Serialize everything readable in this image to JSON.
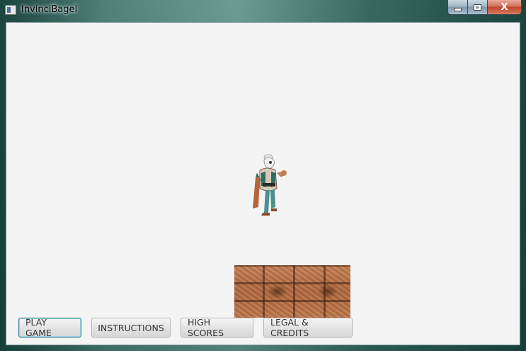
{
  "window": {
    "title": "InvinciBagel",
    "controls": {
      "minimize_icon": "minimize-icon",
      "maximize_icon": "maximize-icon",
      "close_label": "X"
    }
  },
  "game": {
    "background_color": "#f4f4f4",
    "sprites": [
      {
        "name": "invincibagel-character",
        "description_icon": "player-sprite"
      },
      {
        "name": "brick-block",
        "description_icon": "brick-texture"
      }
    ]
  },
  "buttons": [
    {
      "id": "play-game",
      "label": "PLAY GAME",
      "focused": true
    },
    {
      "id": "instructions",
      "label": "INSTRUCTIONS",
      "focused": false
    },
    {
      "id": "high-scores",
      "label": "HIGH SCORES",
      "focused": false
    },
    {
      "id": "legal-credits",
      "label": "LEGAL & CREDITS",
      "focused": false
    }
  ],
  "colors": {
    "frame": "#2f5c55",
    "close_button": "#c0452d",
    "focus_border": "#2f7f9a",
    "brick": "#b0693f"
  }
}
